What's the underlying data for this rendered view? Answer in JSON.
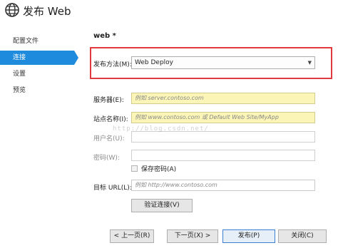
{
  "window": {
    "title": "发布 Web",
    "icon": "globe-icon"
  },
  "sidebar": {
    "items": [
      {
        "label": "配置文件",
        "active": false
      },
      {
        "label": "连接",
        "active": true
      },
      {
        "label": "设置",
        "active": false
      },
      {
        "label": "预览",
        "active": false
      }
    ],
    "accent": "#1e8bdc"
  },
  "profile": {
    "name": "web *"
  },
  "publish_method": {
    "label": "发布方法(M):",
    "value": "Web Deploy",
    "highlight_color": "#e0393e"
  },
  "server": {
    "label": "服务器(E):",
    "placeholder": "例如 server.contoso.com"
  },
  "site_name": {
    "label": "站点名称(I):",
    "placeholder": "例如 www.contoso.com 或 Default Web Site/MyApp"
  },
  "username": {
    "label": "用户名(U):",
    "value": ""
  },
  "password": {
    "label": "密码(W):",
    "value": ""
  },
  "save_password": {
    "label": "保存密码(A)",
    "checked": false
  },
  "target_url": {
    "label": "目标 URL(L):",
    "placeholder": "例如 http://www.contoso.com"
  },
  "validate_button": {
    "label": "验证连接(V)"
  },
  "footer": {
    "prev": "< 上一页(R)",
    "next": "下一页(X) >",
    "publish": "发布(P)",
    "close": "关闭(C)"
  },
  "watermark": "http://blog.csdn.net/"
}
